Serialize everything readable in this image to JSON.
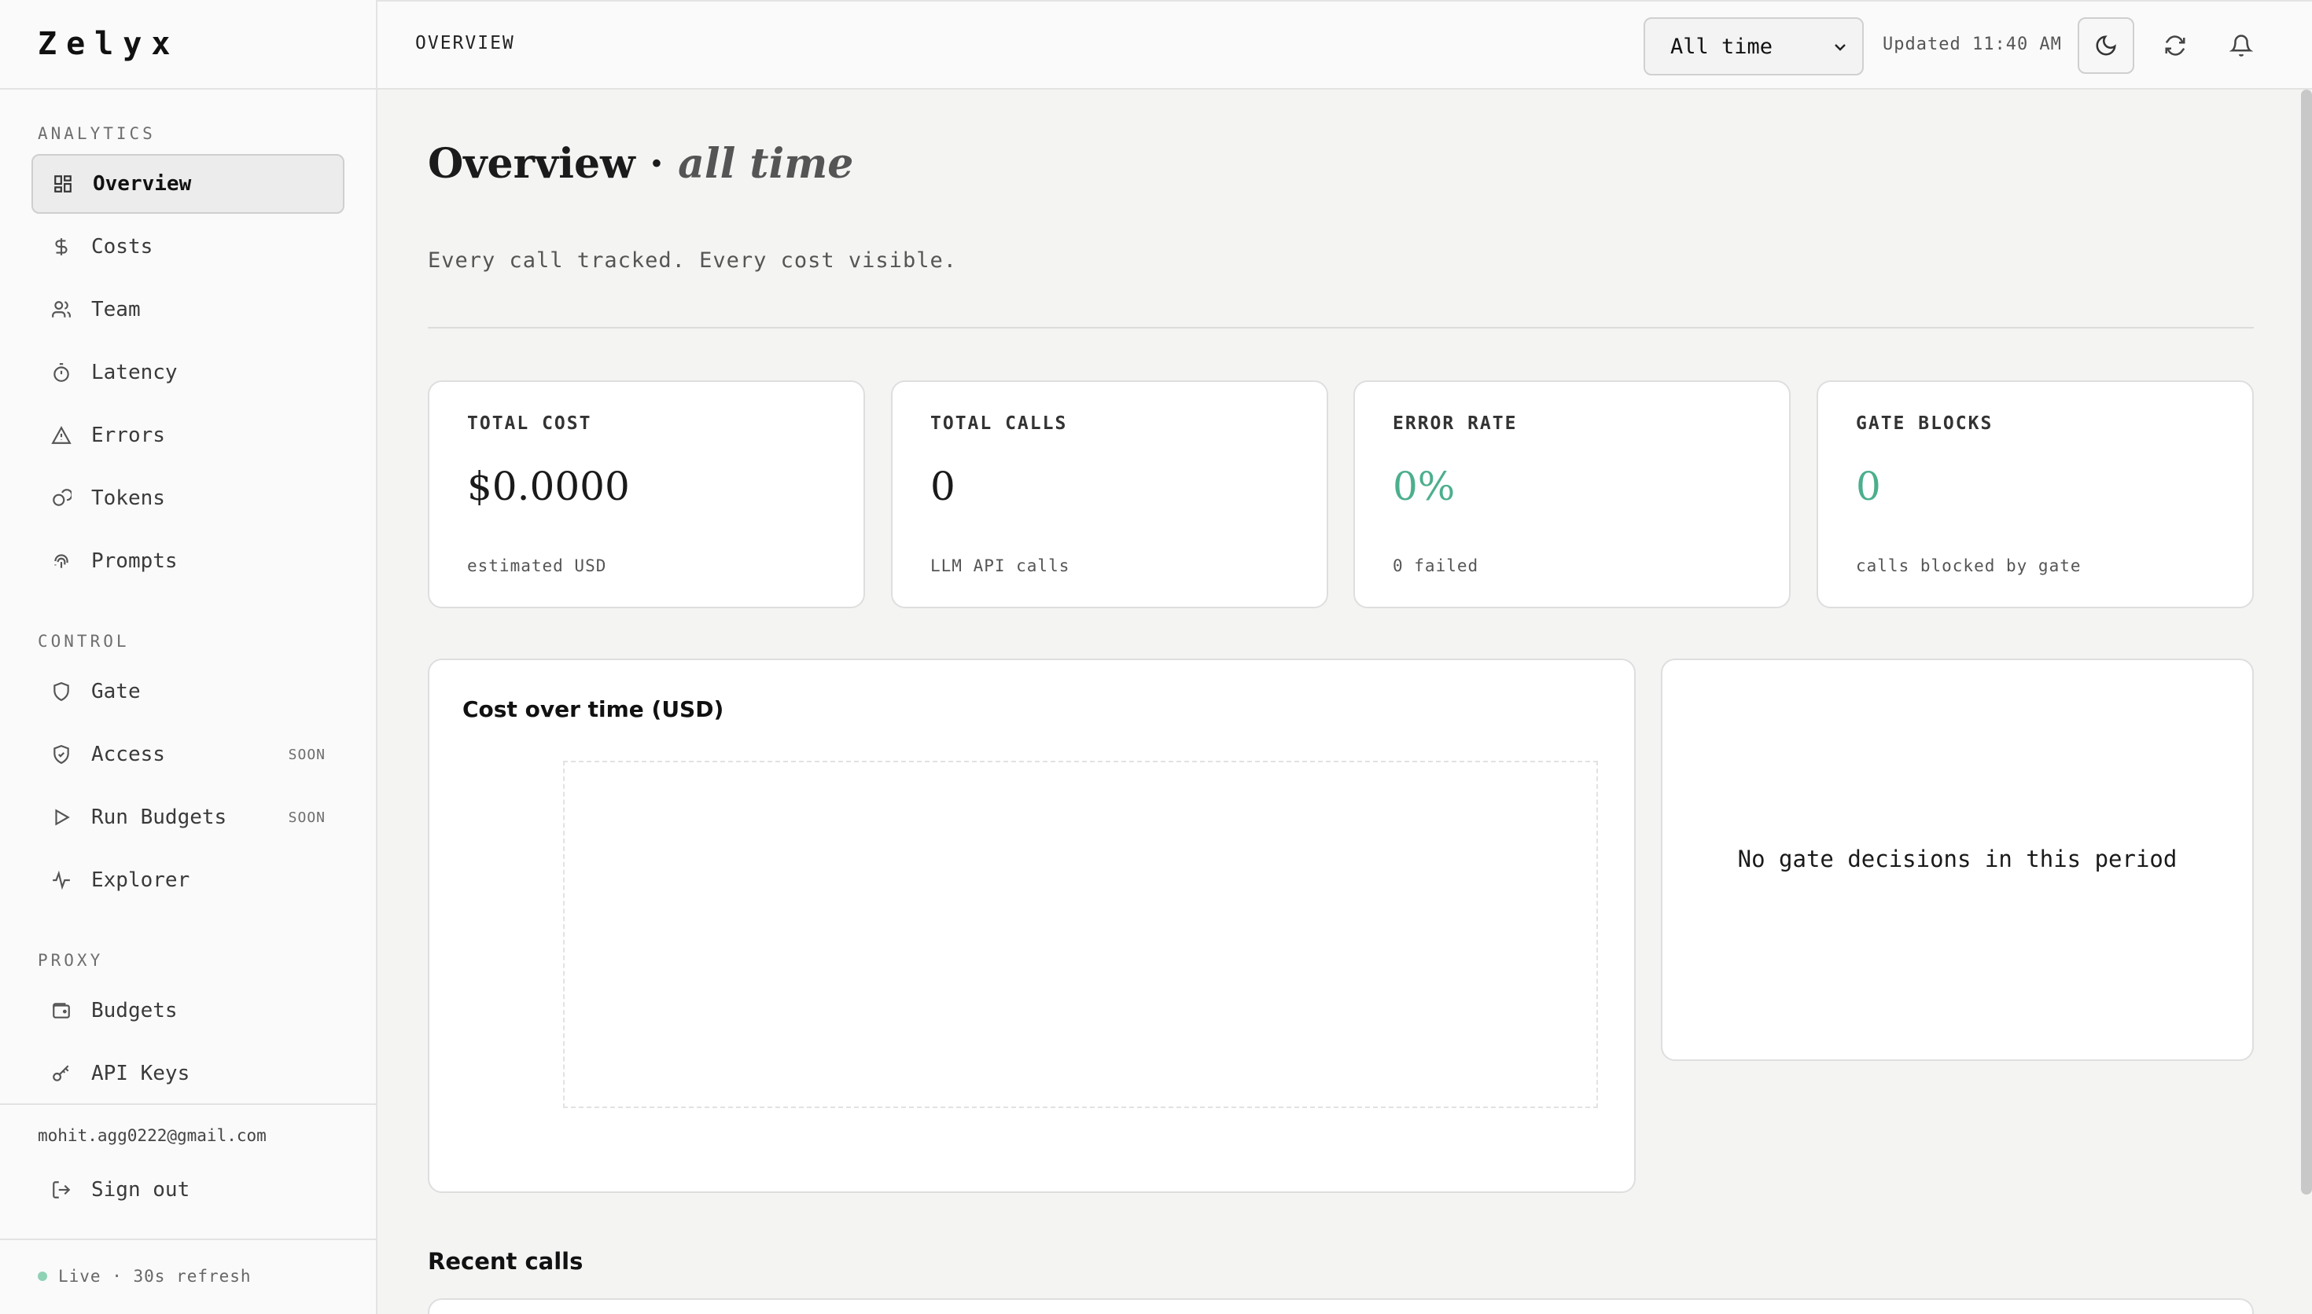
{
  "app": {
    "brand": "Zelyx"
  },
  "sidebar": {
    "sections": {
      "analytics": "ANALYTICS",
      "control": "CONTROL",
      "proxy": "PROXY"
    },
    "items": {
      "overview": {
        "label": "Overview",
        "icon": "grid-icon",
        "active": true
      },
      "costs": {
        "label": "Costs",
        "icon": "dollar-icon"
      },
      "team": {
        "label": "Team",
        "icon": "users-icon"
      },
      "latency": {
        "label": "Latency",
        "icon": "timer-icon"
      },
      "errors": {
        "label": "Errors",
        "icon": "warning-triangle-icon"
      },
      "tokens": {
        "label": "Tokens",
        "icon": "coins-icon"
      },
      "prompts": {
        "label": "Prompts",
        "icon": "fingerprint-icon"
      },
      "gate": {
        "label": "Gate",
        "icon": "shield-icon"
      },
      "access": {
        "label": "Access",
        "icon": "shield-check-icon",
        "badge": "SOON"
      },
      "run_budgets": {
        "label": "Run Budgets",
        "icon": "play-icon",
        "badge": "SOON"
      },
      "explorer": {
        "label": "Explorer",
        "icon": "activity-icon"
      },
      "budgets": {
        "label": "Budgets",
        "icon": "wallet-icon"
      },
      "api_keys": {
        "label": "API Keys",
        "icon": "key-icon"
      }
    },
    "user_email": "mohit.agg0222@gmail.com",
    "sign_out": "Sign out",
    "live_status": "Live · 30s refresh"
  },
  "topbar": {
    "title": "OVERVIEW",
    "period": "All time",
    "updated": "Updated 11:40 AM"
  },
  "main": {
    "title": "Overview ·",
    "title_sub": "all time",
    "tagline": "Every call tracked. Every cost visible.",
    "kpis": {
      "total_cost": {
        "label": "TOTAL COST",
        "value": "$0.0000",
        "note": "estimated USD"
      },
      "total_calls": {
        "label": "TOTAL CALLS",
        "value": "0",
        "note": "LLM API calls"
      },
      "error_rate": {
        "label": "ERROR RATE",
        "value": "0%",
        "note": "0 failed"
      },
      "gate_blocks": {
        "label": "GATE BLOCKS",
        "value": "0",
        "note": "calls blocked by gate"
      }
    },
    "cost_chart_title": "Cost over time (USD)",
    "gate_empty": "No gate decisions in this period",
    "recent_calls_title": "Recent calls"
  },
  "colors": {
    "accent_green": "#4caf8c",
    "live_dot": "#8fd2b6"
  }
}
